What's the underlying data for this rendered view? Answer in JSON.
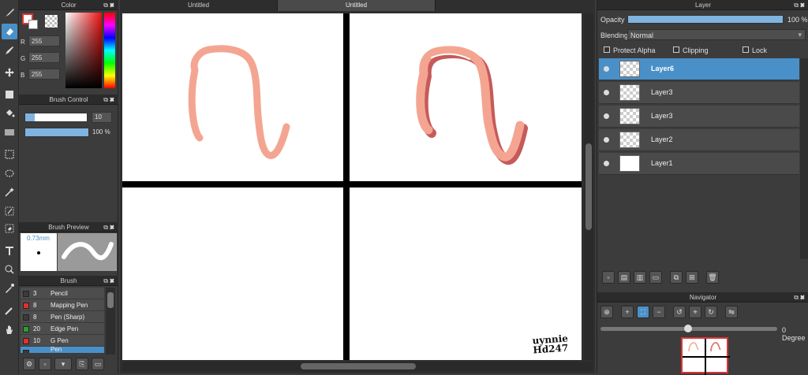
{
  "color_panel": {
    "title": "Color",
    "r_label": "R",
    "g_label": "G",
    "b_label": "B",
    "r": "255",
    "g": "255",
    "b": "255"
  },
  "brush_control": {
    "title": "Brush Control",
    "size": "10",
    "opacity": "100 %"
  },
  "brush_preview": {
    "title": "Brush Preview",
    "size_label": "0.73mm"
  },
  "brush_panel": {
    "title": "Brush",
    "items": [
      {
        "size": "3",
        "name": "Pencil",
        "color": "#3a3a3a"
      },
      {
        "size": "8",
        "name": "Mapping Pen",
        "color": "#e03030"
      },
      {
        "size": "8",
        "name": "Pen (Sharp)",
        "color": "#3a3a3a"
      },
      {
        "size": "20",
        "name": "Edge Pen",
        "color": "#2aa02a"
      },
      {
        "size": "10",
        "name": "G Pen",
        "color": "#e03030"
      },
      {
        "size": "",
        "name": "Pen",
        "color": "#3a3a3a"
      }
    ]
  },
  "doc_tabs": [
    {
      "label": "Untitled"
    },
    {
      "label": "Untitled"
    }
  ],
  "canvas": {
    "signature_line1": "uynnie",
    "signature_line2": "Hd247",
    "stroke_color": "#f4a592"
  },
  "layer_panel": {
    "title": "Layer",
    "opacity_label": "Opacity",
    "opacity_value": "100 %",
    "blending_label": "Blending",
    "blending_value": "Normal",
    "protect_alpha": "Protect Alpha",
    "clipping": "Clipping",
    "lock": "Lock",
    "layers": [
      {
        "name": "Layer6",
        "selected": true
      },
      {
        "name": "Layer3",
        "selected": false
      },
      {
        "name": "Layer3",
        "selected": false
      },
      {
        "name": "Layer2",
        "selected": false
      },
      {
        "name": "Layer1",
        "selected": false
      }
    ]
  },
  "navigator": {
    "title": "Navigator",
    "rotation_label": "0 Degree"
  },
  "accent_color": "#4a90c8"
}
